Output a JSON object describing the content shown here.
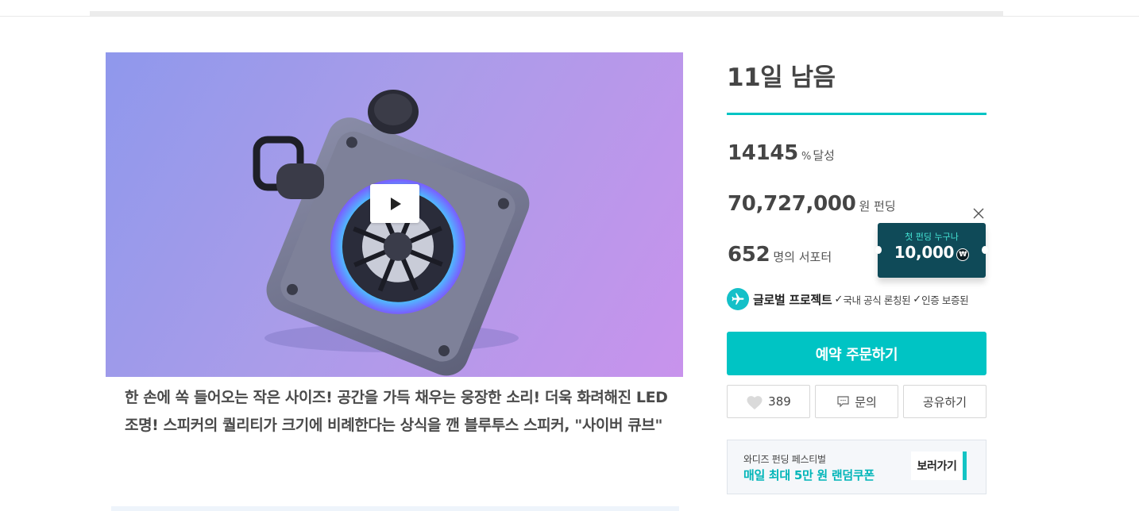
{
  "media": {
    "video_button_icon": "play-icon"
  },
  "description": "한 손에 쏙 들어오는 작은 사이즈! 공간을 가득 채우는 웅장한 소리! 더욱 화려해진 LED 조명! 스피커의 퀄리티가 크기에 비례한다는 상식을 깬 블루투스 스피커, \"사이버 큐브\"",
  "campaign": {
    "days_left": "11일 남음",
    "progress_color": "#00c4c4",
    "percent": "14145",
    "percent_symbol": "%",
    "percent_label": "달성",
    "amount": "70,727,000",
    "amount_unit": "원 펀딩",
    "supporters": "652",
    "supporters_unit": "명의 서포터"
  },
  "coupon": {
    "headline": "첫 펀딩 누구나",
    "amount": "10,000",
    "currency_symbol": "₩",
    "close_icon": "close-icon"
  },
  "global_project": {
    "icon": "airplane-icon",
    "title": "글로벌 프로젝트",
    "badge_1": "국내 공식 론칭된",
    "badge_2": "인증 보증된"
  },
  "actions": {
    "order_label": "예약 주문하기",
    "like_count": "389",
    "inquiry_label": "문의",
    "share_label": "공유하기"
  },
  "banner": {
    "line1": "와디즈 펀딩 페스티벌",
    "line2": "매일 최대 5만 원 랜덤쿠폰",
    "button_label": "보러가기"
  },
  "colors": {
    "accent": "#00c4c4",
    "coupon_bg": "#0f4a58",
    "coupon_accent": "#45e3d4"
  }
}
